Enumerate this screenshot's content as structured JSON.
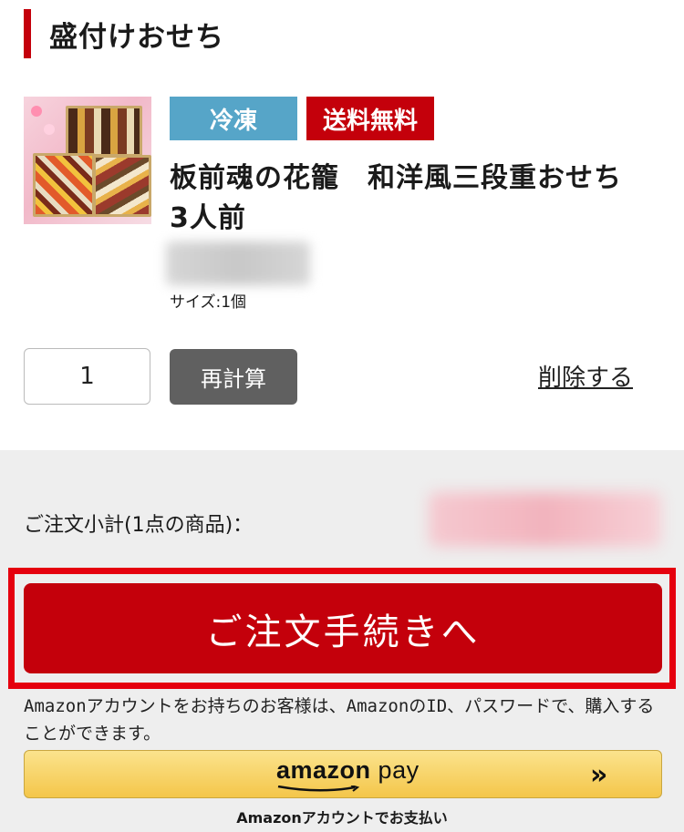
{
  "section": {
    "title": "盛付けおせち"
  },
  "product": {
    "tags": {
      "frozen": "冷凍",
      "free_shipping": "送料無料"
    },
    "name": "板前魂の花籠　和洋風三段重おせち　3人前",
    "price": "¥--,---",
    "size": "サイズ:1個",
    "quantity": "1"
  },
  "actions": {
    "recalc": "再計算",
    "delete": "削除する"
  },
  "summary": {
    "subtotal_label": "ご注文小計(1点の商品)：",
    "subtotal_value": "¥--,---"
  },
  "checkout": {
    "label": "ご注文手続きへ"
  },
  "amazon": {
    "note": "Amazonアカウントをお持ちのお客様は、AmazonのID、パスワードで、購入することができます。",
    "logo_text": "amazon",
    "logo_pay": "pay",
    "chevron": "»",
    "caption": "Amazonアカウントでお支払い"
  },
  "colors": {
    "accent": "#c4000b",
    "frozen_tag": "#56a5c8",
    "highlight": "#e5000e",
    "amazon_button": "#f4c64a"
  }
}
